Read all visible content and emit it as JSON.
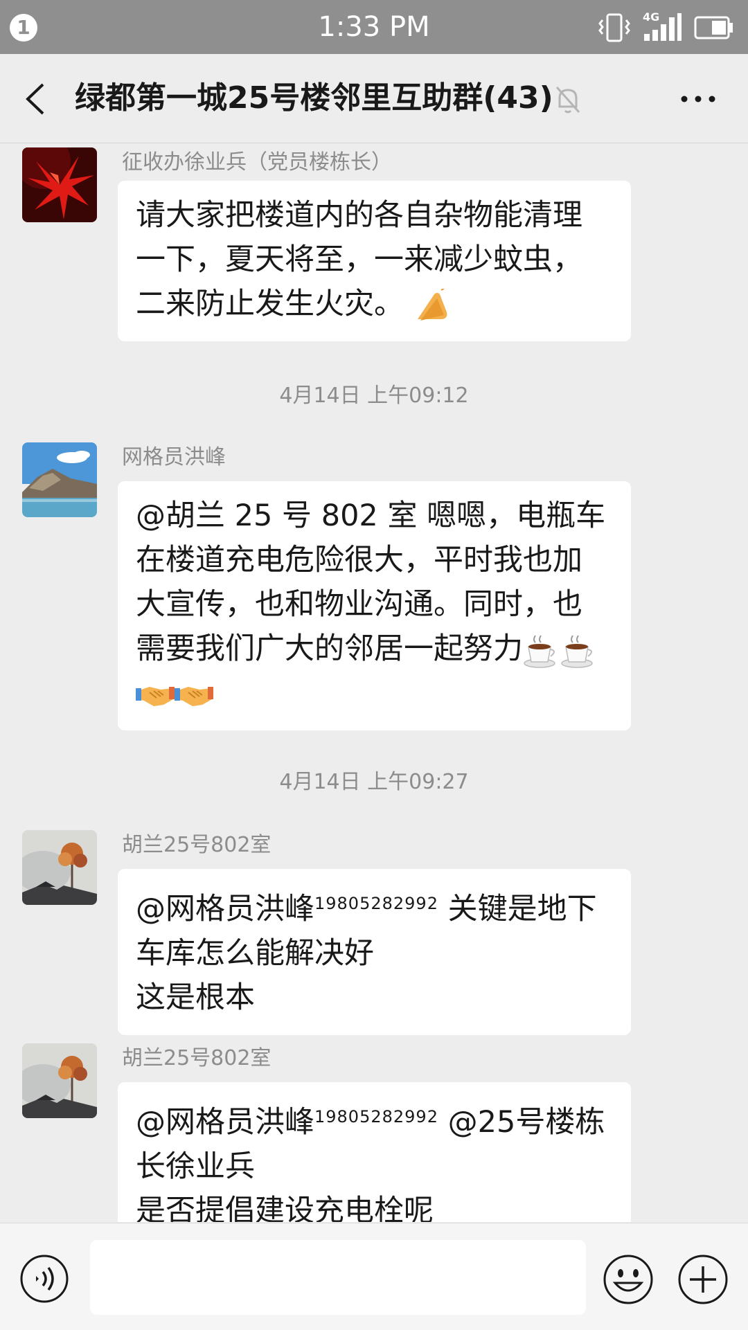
{
  "status_bar": {
    "notification_count": "1",
    "time": "1:33 PM",
    "network": "4G"
  },
  "header": {
    "title": "绿都第一城25号楼邻里互助群(43)"
  },
  "messages": [
    {
      "sender": "征收办徐业兵（党员楼栋长）",
      "lines": [
        "请大家把楼道内的各自杂物能清理",
        "一下，夏天将至，一来减少蚊虫，",
        "二来防止发生火灾。"
      ]
    },
    {
      "timestamp": "4月14日 上午09:12",
      "sender": "网格员洪峰",
      "lines": [
        "@胡兰 25 号 802 室  嗯嗯，电瓶车",
        "在楼道充电危险很大，平时我也加",
        "大宣传，也和物业沟通。同时，也",
        "需要我们广大的邻居一起努力"
      ]
    },
    {
      "timestamp": "4月14日 上午09:27",
      "sender": "胡兰25号802室",
      "mention": "@网格员洪峰",
      "phone": "19805282992",
      "line1_rest": " 关键是地下",
      "lines": [
        "车库怎么能解决好",
        "这是根本"
      ]
    },
    {
      "sender": "胡兰25号802室",
      "mention": "@网格员洪峰",
      "phone": "19805282992",
      "line1_rest": " @25号楼栋",
      "lines": [
        "长徐业兵",
        "是否提倡建设充电栓呢"
      ]
    }
  ],
  "input": {
    "value": "",
    "placeholder": ""
  },
  "icons": {
    "back": "back-arrow-icon",
    "mute": "mute-bell-icon",
    "more": "more-dots-icon",
    "voice": "voice-icon",
    "emoji": "smiley-icon",
    "plus": "plus-icon"
  }
}
